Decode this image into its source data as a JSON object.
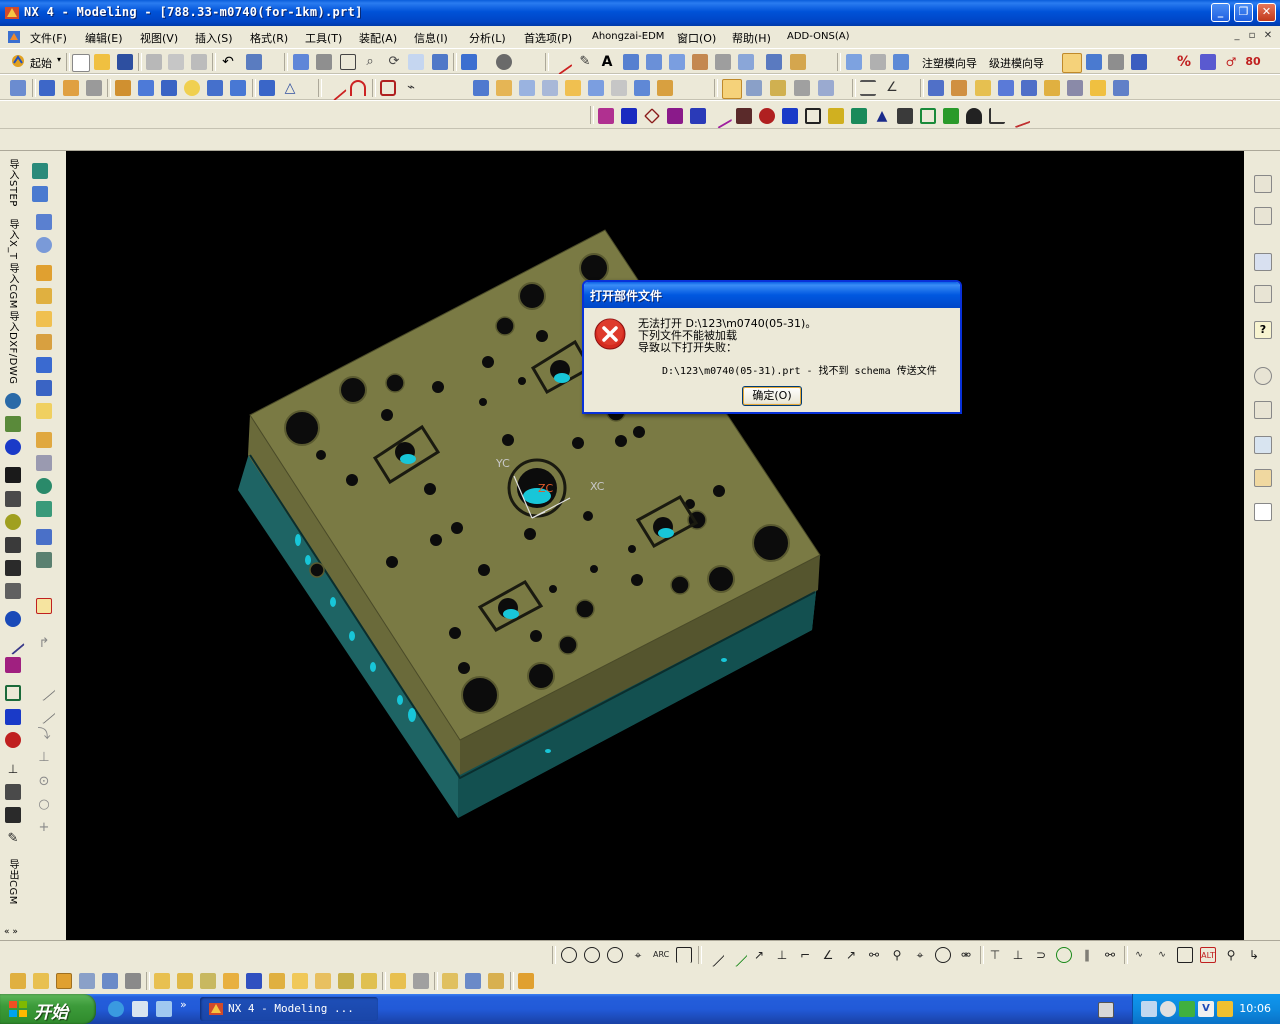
{
  "window": {
    "title": "NX 4 - Modeling - [788.33-m0740(for-1km).prt]",
    "controls": {
      "minimize": "_",
      "restore": "❐",
      "close": "✕"
    }
  },
  "menu": {
    "items": [
      "文件(F)",
      "编辑(E)",
      "视图(V)",
      "插入(S)",
      "格式(R)",
      "工具(T)",
      "装配(A)",
      "信息(I)",
      "分析(L)",
      "首选项(P)",
      "Ahongzai-EDM",
      "窗口(O)",
      "帮助(H)",
      "ADD-ONS(A)"
    ]
  },
  "toolbar": {
    "start_label": "起始",
    "wizard_labels": [
      "注塑模向导",
      "级进模向导"
    ]
  },
  "left_palette": {
    "vertical_labels": [
      "导入STEP",
      "导入X_T",
      "导入CGM",
      "导入DXF/DWG"
    ],
    "bottom_label": "导出CGM"
  },
  "viewport": {
    "axis_labels": {
      "yc": "YC",
      "xc": "XC",
      "zc": "ZC"
    },
    "colors": {
      "top_face": "#7a7a44",
      "side_face": "#1f6a6a",
      "hole_highlight": "#18c6d8",
      "background": "#000000"
    }
  },
  "dialog": {
    "title": "打开部件文件",
    "line1": "无法打开 D:\\123\\m0740(05-31)。",
    "line2": "下列文件不能被加载",
    "line3": "导致以下打开失败：",
    "detail": "D:\\123\\m0740(05-31).prt - 找不到 schema 传送文件",
    "ok_label": "确定(O)",
    "icon": "error-icon"
  },
  "taskbar": {
    "start_label": "开始",
    "task_label": "NX 4 - Modeling ...",
    "clock": "10:06"
  }
}
